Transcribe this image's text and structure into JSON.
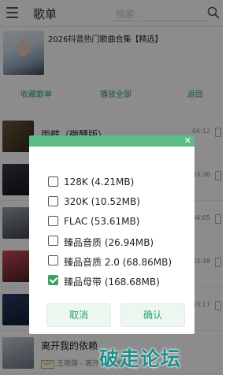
{
  "app": {
    "title": "歌单"
  },
  "search": {
    "placeholder": "搜索..."
  },
  "playlist": {
    "title": "2026抖音热门歌曲合集【精选】"
  },
  "actions": {
    "favorite": "收藏歌单",
    "play_all": "播放全部",
    "back": "返回"
  },
  "songs": [
    {
      "title": "雨蝶（微醺版）",
      "duration": "04:12"
    },
    {
      "title": "",
      "duration": "03:36"
    },
    {
      "title": "",
      "duration": "04:05"
    },
    {
      "title": "",
      "duration": "03:48"
    },
    {
      "title": "",
      "duration": "03:17"
    },
    {
      "title": "离开我的依赖",
      "subtitle": "王艳薇 - 离开我的依赖",
      "duration": ""
    }
  ],
  "dialog": {
    "options": [
      {
        "label": "128K (4.21MB)",
        "checked": false
      },
      {
        "label": "320K (10.52MB)",
        "checked": false
      },
      {
        "label": "FLAC (53.61MB)",
        "checked": false
      },
      {
        "label": "臻品音质 (26.94MB)",
        "checked": false
      },
      {
        "label": "臻品音质 2.0 (68.86MB)",
        "checked": false
      },
      {
        "label": "臻品母带 (168.68MB)",
        "checked": true
      }
    ],
    "cancel_label": "取消",
    "confirm_label": "确认"
  },
  "watermark": "破走论坛",
  "colors": {
    "accent": "#2aa66b",
    "dialog_header": "#5bbd85",
    "checkbox_checked": "#3ea066"
  }
}
